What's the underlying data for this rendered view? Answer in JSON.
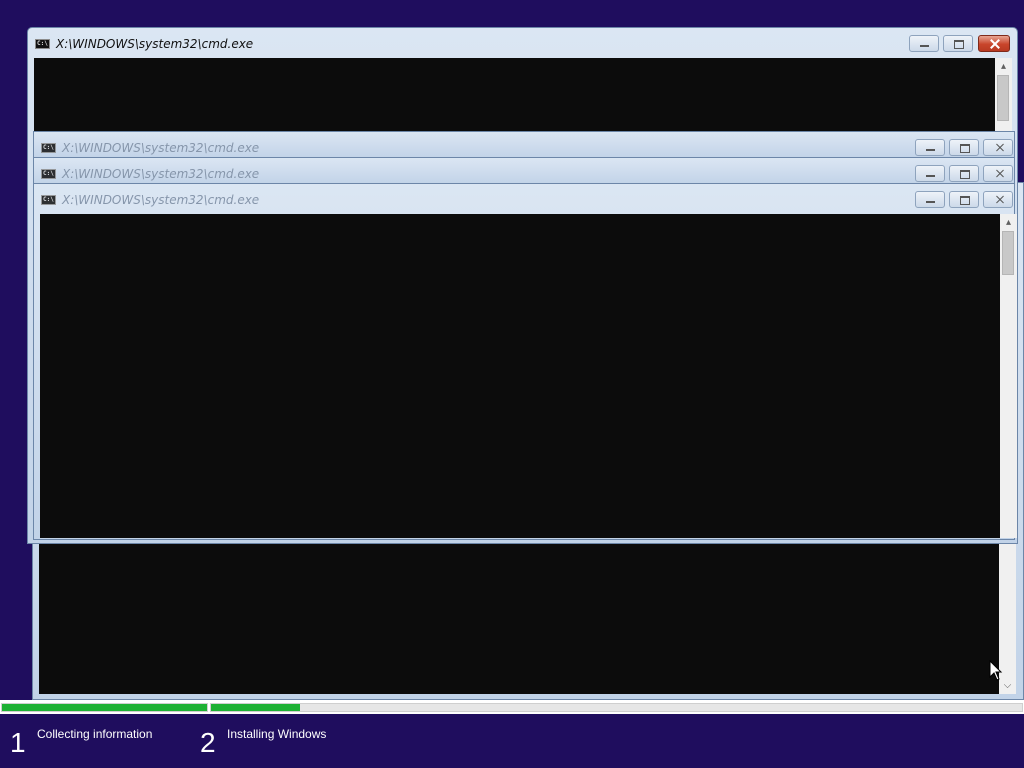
{
  "windows": {
    "background": {
      "title": "X:\\WINDOWS\\system32\\cmd.exe"
    },
    "stacked_1": {
      "title": "X:\\WINDOWS\\system32\\cmd.exe"
    },
    "stacked_2": {
      "title": "X:\\WINDOWS\\system32\\cmd.exe"
    },
    "front": {
      "title": "X:\\WINDOWS\\system32\\cmd.exe"
    },
    "console_icon_text": "C:\\"
  },
  "setup": {
    "steps": [
      {
        "number": "1",
        "label": "Collecting information",
        "progress": 1.0
      },
      {
        "number": "2",
        "label": "Installing Windows",
        "progress": 0.11
      }
    ]
  },
  "colors": {
    "desktop": "#1f0d5e",
    "progress_fill": "#1eb134",
    "console": "#0c0c0c",
    "close_button": "#c8452b"
  },
  "icons": {
    "window_icon": "console-icon",
    "minimize": "minimize-icon",
    "maximize": "maximize-icon",
    "close": "close-icon",
    "scroll_up": "scroll-up-arrow-icon",
    "scroll_down": "scroll-down-arrow-icon",
    "cursor": "mouse-pointer-icon"
  }
}
